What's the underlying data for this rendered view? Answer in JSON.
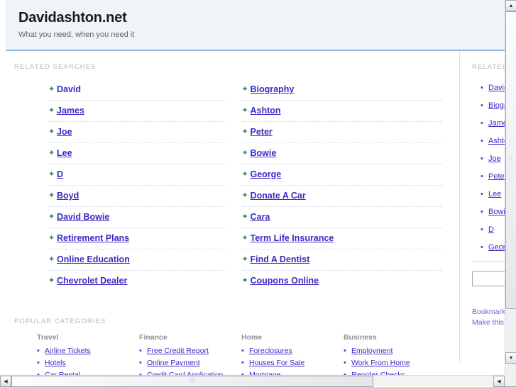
{
  "header": {
    "title": "Davidashton.net",
    "tagline": "What you need, when you need it"
  },
  "main": {
    "related_searches_label": "RELATED SEARCHES",
    "related_searches": {
      "left": [
        {
          "label": "David",
          "underlined": false
        },
        {
          "label": "James",
          "underlined": true
        },
        {
          "label": "Joe",
          "underlined": true
        },
        {
          "label": "Lee",
          "underlined": true
        },
        {
          "label": "D",
          "underlined": true
        },
        {
          "label": "Boyd",
          "underlined": true
        },
        {
          "label": "David Bowie",
          "underlined": true
        },
        {
          "label": "Retirement Plans",
          "underlined": true
        },
        {
          "label": "Online Education",
          "underlined": true
        },
        {
          "label": "Chevrolet Dealer",
          "underlined": true
        }
      ],
      "right": [
        {
          "label": "Biography",
          "underlined": true
        },
        {
          "label": "Ashton",
          "underlined": true
        },
        {
          "label": "Peter",
          "underlined": true
        },
        {
          "label": "Bowie",
          "underlined": true
        },
        {
          "label": "George",
          "underlined": true
        },
        {
          "label": "Donate A Car",
          "underlined": true
        },
        {
          "label": "Cara",
          "underlined": true
        },
        {
          "label": "Term Life Insurance",
          "underlined": true
        },
        {
          "label": "Find A Dentist",
          "underlined": true
        },
        {
          "label": "Coupons Online",
          "underlined": true
        }
      ]
    },
    "popular_categories_label": "POPULAR CATEGORIES",
    "categories": [
      {
        "heading": "Travel",
        "links": [
          "Airline Tickets",
          "Hotels",
          "Car Rental"
        ]
      },
      {
        "heading": "Finance",
        "links": [
          "Free Credit Report",
          "Online Payment",
          "Credit Card Application"
        ]
      },
      {
        "heading": "Home",
        "links": [
          "Foreclosures",
          "Houses For Sale",
          "Mortgage"
        ]
      },
      {
        "heading": "Business",
        "links": [
          "Employment",
          "Work From Home",
          "Reorder Checks"
        ]
      }
    ]
  },
  "sidebar": {
    "label": "RELATED SEARCHES",
    "items": [
      "David",
      "Biography",
      "James",
      "Ashton",
      "Joe",
      "Peter",
      "Lee",
      "Bowie",
      "D",
      "George"
    ],
    "search_value": "",
    "search_placeholder": "",
    "footer_links": [
      "Bookmark this page",
      "Make this my homepage"
    ]
  },
  "icons": {
    "arrow_bullet": "✦",
    "dot_bullet": "•",
    "scroll_up": "▲",
    "scroll_down": "▼",
    "scroll_left": "◀",
    "scroll_right": "▶",
    "grip": "⣿"
  },
  "colors": {
    "header_bg": "#eef4f8",
    "header_rule": "#8fb4d9",
    "link": "#3b2bc4",
    "arrow_green": "#2e8b6f",
    "label_gray": "#b3b8bd"
  }
}
